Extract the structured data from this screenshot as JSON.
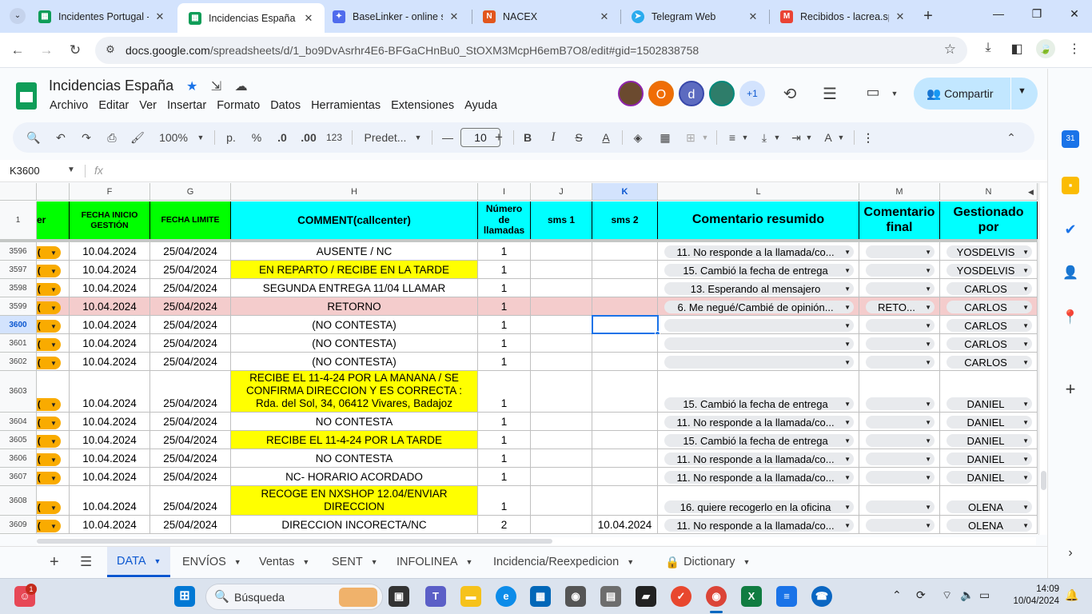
{
  "browser": {
    "tabs": [
      {
        "title": "Incidentes Portugal - ",
        "icon": "sheets-icon",
        "color": "#0f9d58"
      },
      {
        "title": "Incidencias España - ",
        "icon": "sheets-icon",
        "color": "#0f9d58"
      },
      {
        "title": "BaseLinker - online sa",
        "icon": "baselinker-icon",
        "color": "#4f6bed"
      },
      {
        "title": "NACEX",
        "icon": "nacex-icon",
        "color": "#e2561c"
      },
      {
        "title": "Telegram Web",
        "icon": "telegram-icon",
        "color": "#2aabee"
      },
      {
        "title": "Recibidos - lacrea.spa",
        "icon": "gmail-icon",
        "color": "#ea4335"
      }
    ],
    "url_domain": "docs.google.com",
    "url_path": "/spreadsheets/d/1_bo9DvAsrhr4E6-BFGaCHnBu0_StOXM3McpH6emB7O8/edit#gid=1502838758"
  },
  "doc": {
    "title": "Incidencias España",
    "menu": [
      "Archivo",
      "Editar",
      "Ver",
      "Insertar",
      "Formato",
      "Datos",
      "Herramientas",
      "Extensiones",
      "Ayuda"
    ],
    "avatars": [
      {
        "label": "",
        "color": "#6b4a2f"
      },
      {
        "label": "O",
        "color": "#f06d06"
      },
      {
        "label": "d",
        "color": "#5c6bc0"
      },
      {
        "label": "",
        "color": "#2e7d6a"
      },
      {
        "label": "+1",
        "color": "#d3e3fd"
      }
    ],
    "share_label": "Compartir"
  },
  "toolbar": {
    "zoom": "100%",
    "currency_p": "p.",
    "percent": "%",
    "dec_less": ".0",
    "dec_more": ".00",
    "num_format": "123",
    "font": "Predet...",
    "font_size": "10"
  },
  "formula_bar": {
    "name_box": "K3600",
    "fx": "fx"
  },
  "columns": [
    {
      "letter": "F"
    },
    {
      "letter": "G"
    },
    {
      "letter": "H"
    },
    {
      "letter": "I"
    },
    {
      "letter": "J"
    },
    {
      "letter": "K"
    },
    {
      "letter": "L"
    },
    {
      "letter": "M"
    },
    {
      "letter": "N"
    }
  ],
  "header_row": {
    "row_num": "1",
    "er": "er",
    "F": "FECHA INICIO GESTIÓN",
    "G": "FECHA LIMITE",
    "H": "COMMENT(callcenter)",
    "I": "Número de llamadas",
    "J": "sms 1",
    "K": "sms 2",
    "L": "Comentario resumido",
    "M": "Comentario final",
    "N": "Gestionado por"
  },
  "rows": [
    {
      "num": "3596",
      "F": "10.04.2024",
      "G": "25/04/2024",
      "H": "AUSENTE / NC",
      "I": "1",
      "K": "",
      "L": "11. No responde a la llamada/co...",
      "M": "",
      "N": "YOSDELVIS"
    },
    {
      "num": "3597",
      "F": "10.04.2024",
      "G": "25/04/2024",
      "H": "EN REPARTO / RECIBE EN LA TARDE",
      "I": "1",
      "K": "",
      "L": "15. Cambió la fecha de entrega",
      "M": "",
      "N": "YOSDELVIS"
    },
    {
      "num": "3598",
      "F": "10.04.2024",
      "G": "25/04/2024",
      "H": "SEGUNDA ENTREGA 11/04 LLAMAR",
      "I": "1",
      "K": "",
      "L": "13. Esperando al mensajero",
      "M": "",
      "N": "CARLOS"
    },
    {
      "num": "3599",
      "F": "10.04.2024",
      "G": "25/04/2024",
      "H": "RETORNO",
      "I": "1",
      "K": "",
      "L": "6. Me negué/Cambié de opinión...",
      "M": "RETO...",
      "N": "CARLOS"
    },
    {
      "num": "3600",
      "F": "10.04.2024",
      "G": "25/04/2024",
      "H": "(NO CONTESTA)",
      "I": "1",
      "K": "",
      "L": "",
      "M": "",
      "N": "CARLOS"
    },
    {
      "num": "3601",
      "F": "10.04.2024",
      "G": "25/04/2024",
      "H": "(NO CONTESTA)",
      "I": "1",
      "K": "",
      "L": "",
      "M": "",
      "N": "CARLOS"
    },
    {
      "num": "3602",
      "F": "10.04.2024",
      "G": "25/04/2024",
      "H": "(NO CONTESTA)",
      "I": "1",
      "K": "",
      "L": "",
      "M": "",
      "N": "CARLOS"
    },
    {
      "num": "3603",
      "F": "10.04.2024",
      "G": "25/04/2024",
      "H": "RECIBE EL 11-4-24 POR LA MANANA / SE CONFIRMA DIRECCION Y ES CORRECTA : Rda. del Sol, 34, 06412 Vivares, Badajoz",
      "I": "1",
      "K": "",
      "L": "15. Cambió la fecha de entrega",
      "M": "",
      "N": "DANIEL"
    },
    {
      "num": "3604",
      "F": "10.04.2024",
      "G": "25/04/2024",
      "H": "NO CONTESTA",
      "I": "1",
      "K": "",
      "L": "11. No responde a la llamada/co...",
      "M": "",
      "N": "DANIEL"
    },
    {
      "num": "3605",
      "F": "10.04.2024",
      "G": "25/04/2024",
      "H": "RECIBE EL 11-4-24 POR LA TARDE",
      "I": "1",
      "K": "",
      "L": "15. Cambió la fecha de entrega",
      "M": "",
      "N": "DANIEL"
    },
    {
      "num": "3606",
      "F": "10.04.2024",
      "G": "25/04/2024",
      "H": "NO CONTESTA",
      "I": "1",
      "K": "",
      "L": "11. No responde a la llamada/co...",
      "M": "",
      "N": "DANIEL"
    },
    {
      "num": "3607",
      "F": "10.04.2024",
      "G": "25/04/2024",
      "H": "NC- HORARIO ACORDADO",
      "I": "1",
      "K": "",
      "L": "11. No responde a la llamada/co...",
      "M": "",
      "N": "DANIEL"
    },
    {
      "num": "3608",
      "F": "",
      "G": "",
      "H": "RECOGE EN NXSHOP 12.04/ENVIAR DIRECCION",
      "I": "1",
      "K": "",
      "L": "16. quiere recogerlo en la oficina",
      "M": "",
      "N": "OLENA"
    },
    {
      "num": "3609",
      "F": "10.04.2024",
      "G": "25/04/2024",
      "H": "DIRECCION INCORECTA/NC",
      "I": "2",
      "K": "10.04.2024",
      "L": "11. No responde a la llamada/co...",
      "M": "",
      "N": "OLENA"
    }
  ],
  "row3608_dates": {
    "F": "10.04.2024",
    "G": "25/04/2024"
  },
  "sheet_tabs": [
    "DATA",
    "ENVÍOS",
    "Ventas",
    "SENT",
    "INFOLINEA",
    "Incidencia/Reexpedicion",
    "Dictionary"
  ],
  "taskbar": {
    "search_placeholder": "Búsqueda",
    "notification_count": "1",
    "time": "14:09",
    "date": "10/04/2024"
  },
  "colors": {
    "header_green": "#00ff00",
    "header_cyan": "#00ffff",
    "highlight_yellow": "#ffff00",
    "row_pink": "#f4cccc",
    "orange_chip": "#f9ab00"
  }
}
